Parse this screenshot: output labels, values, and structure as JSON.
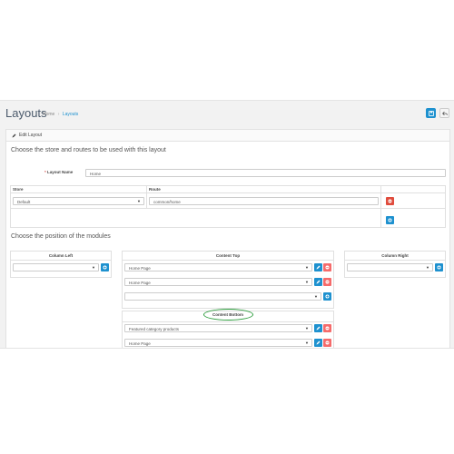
{
  "header": {
    "title": "Layouts",
    "breadcrumb": [
      "Home",
      "Layouts"
    ],
    "save_icon": "save-icon",
    "back_icon": "reply-icon"
  },
  "panel": {
    "heading": "Edit Layout",
    "store_section_title": "Choose the store and routes to be used with this layout",
    "layout_name_label": "Layout Name",
    "layout_name_value": "Home",
    "store_column": "Store",
    "route_column": "Route",
    "store_value": "Default",
    "route_value": "common/home",
    "modules_section_title": "Choose the position of the modules"
  },
  "modules": {
    "column_left": {
      "title": "Column Left",
      "selected": ""
    },
    "column_right": {
      "title": "Column Right",
      "selected": ""
    },
    "content_top": {
      "title": "Content Top",
      "rows": [
        "Home Page",
        "Home Page",
        ""
      ]
    },
    "content_bottom": {
      "title": "Content Bottom",
      "rows": [
        "Featured category products",
        "Home Page"
      ]
    }
  },
  "colors": {
    "primary": "#1e91cf",
    "danger": "#f56b6b",
    "highlight": "#2e9d3e"
  }
}
